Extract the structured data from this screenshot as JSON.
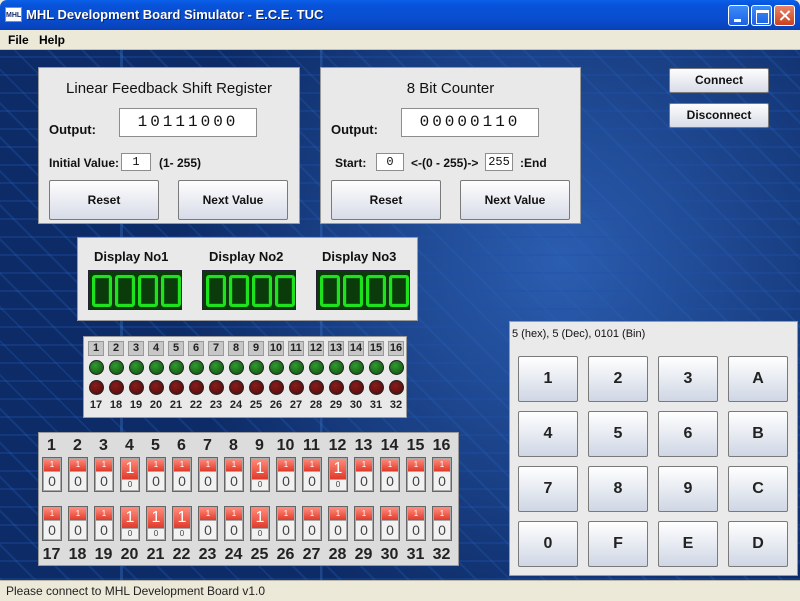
{
  "window": {
    "title": "MHL Development Board Simulator - E.C.E. TUC",
    "icon_text": "MHL"
  },
  "menu": [
    "File",
    "Help"
  ],
  "lfsr": {
    "title": "Linear Feedback Shift Register",
    "output_label": "Output:",
    "output": "10111000",
    "init_label": "Initial Value:",
    "init_value": "1",
    "range_hint": "(1- 255)",
    "reset": "Reset",
    "next": "Next Value"
  },
  "counter": {
    "title": "8 Bit Counter",
    "output_label": "Output:",
    "output": "00000110",
    "start_label": "Start:",
    "start_value": "0",
    "range_text": "<-(0 - 255)->",
    "end_value": "255",
    "end_label": ":End",
    "reset": "Reset",
    "next": "Next Value"
  },
  "connection": {
    "connect": "Connect",
    "disconnect": "Disconnect"
  },
  "displays": [
    {
      "label": "Display No1"
    },
    {
      "label": "Display No2"
    },
    {
      "label": "Display No3"
    }
  ],
  "leds": {
    "top_numbers": [
      "1",
      "2",
      "3",
      "4",
      "5",
      "6",
      "7",
      "8",
      "9",
      "10",
      "11",
      "12",
      "13",
      "14",
      "15",
      "16"
    ],
    "bottom_numbers": [
      "17",
      "18",
      "19",
      "20",
      "21",
      "22",
      "23",
      "24",
      "25",
      "26",
      "27",
      "28",
      "29",
      "30",
      "31",
      "32"
    ],
    "top_color": "#1a7a1a",
    "bottom_color": "#6a1212"
  },
  "switches": {
    "top_numbers": [
      "1",
      "2",
      "3",
      "4",
      "5",
      "6",
      "7",
      "8",
      "9",
      "10",
      "11",
      "12",
      "13",
      "14",
      "15",
      "16"
    ],
    "bottom_numbers": [
      "17",
      "18",
      "19",
      "20",
      "21",
      "22",
      "23",
      "24",
      "25",
      "26",
      "27",
      "28",
      "29",
      "30",
      "31",
      "32"
    ],
    "top_states": [
      0,
      0,
      0,
      1,
      0,
      0,
      0,
      0,
      1,
      0,
      0,
      1,
      0,
      0,
      0,
      0
    ],
    "bottom_states": [
      0,
      0,
      0,
      1,
      1,
      1,
      0,
      0,
      1,
      0,
      0,
      0,
      0,
      0,
      0,
      0
    ],
    "on_glyph": "1",
    "off_glyph": "0"
  },
  "keypad": {
    "readout": "5 (hex), 5 (Dec), 0101 (Bin)",
    "keys": [
      "1",
      "2",
      "3",
      "A",
      "4",
      "5",
      "6",
      "B",
      "7",
      "8",
      "9",
      "C",
      "0",
      "F",
      "E",
      "D"
    ]
  },
  "status": "Please connect to MHL Development Board v1.0"
}
